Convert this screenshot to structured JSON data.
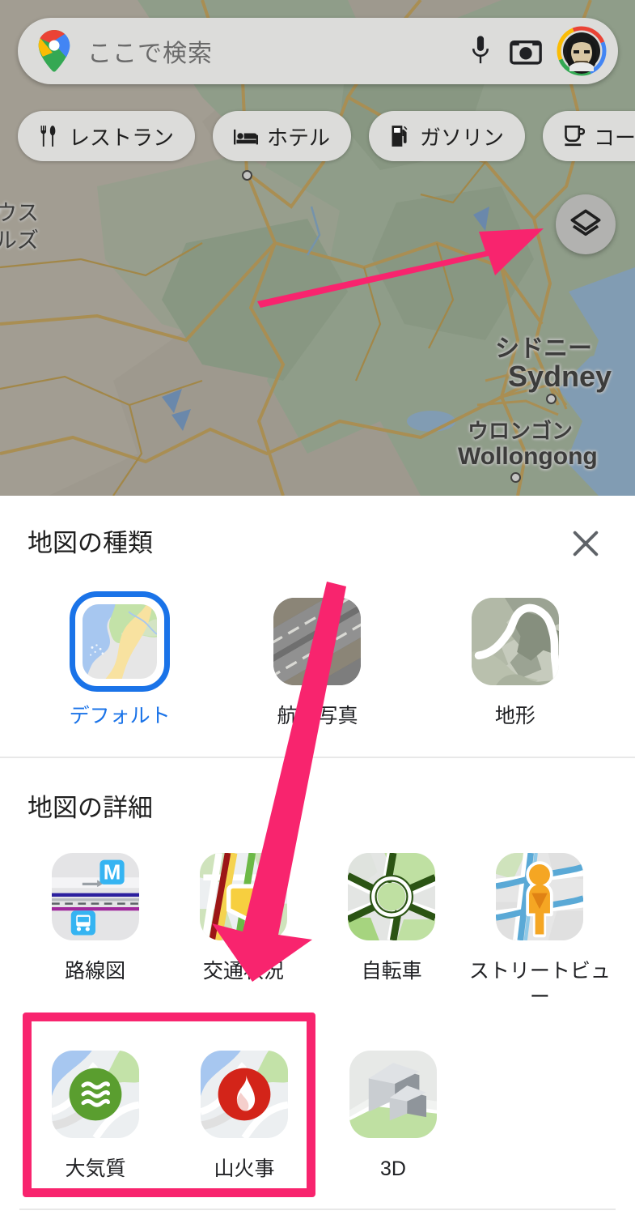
{
  "app": {
    "name": "Google Maps",
    "accent_blue": "#1a73e8",
    "annotation_pink": "#f8246e"
  },
  "search": {
    "placeholder": "ここで検索",
    "value": "",
    "logo_icon": "google-maps-pin-icon",
    "voice_icon": "microphone-icon",
    "camera_icon": "camera-icon",
    "avatar_icon": "account-avatar"
  },
  "chips": [
    {
      "label": "レストラン",
      "icon": "restaurant-icon"
    },
    {
      "label": "ホテル",
      "icon": "hotel-icon"
    },
    {
      "label": "ガソリン",
      "icon": "gas-station-icon"
    },
    {
      "label": "コーヒー",
      "icon": "coffee-icon"
    }
  ],
  "map": {
    "layers_button_icon": "layers-icon",
    "labels": [
      {
        "name": "region-label",
        "text": "ウス"
      },
      {
        "name": "region-label-2",
        "text": "ルズ"
      },
      {
        "name": "city-label-sydney-ja",
        "text": "シドニー"
      },
      {
        "name": "city-label-sydney-en",
        "text": "Sydney"
      },
      {
        "name": "city-label-wollongong-ja",
        "text": "ウロンゴン"
      },
      {
        "name": "city-label-wollongong-en",
        "text": "Wollongong"
      }
    ]
  },
  "sheet": {
    "title": "地図の種類",
    "close_icon": "close-icon",
    "map_types": [
      {
        "label": "デフォルト",
        "icon": "map-default-icon",
        "selected": true
      },
      {
        "label": "航空写真",
        "icon": "map-satellite-icon",
        "selected": false
      },
      {
        "label": "地形",
        "icon": "map-terrain-icon",
        "selected": false
      }
    ],
    "details_title": "地図の詳細",
    "details": [
      {
        "label": "路線図",
        "icon": "transit-icon",
        "highlighted": false
      },
      {
        "label": "交通状況",
        "icon": "traffic-icon",
        "highlighted": false
      },
      {
        "label": "自転車",
        "icon": "bicycling-icon",
        "highlighted": false
      },
      {
        "label": "ストリートビュー",
        "icon": "street-view-icon",
        "highlighted": false
      },
      {
        "label": "大気質",
        "icon": "air-quality-icon",
        "highlighted": true
      },
      {
        "label": "山火事",
        "icon": "wildfire-icon",
        "highlighted": true
      },
      {
        "label": "3D",
        "icon": "three-d-icon",
        "highlighted": false
      }
    ]
  },
  "annotations": {
    "arrow_to_layers_button": "pink-arrow-right",
    "arrow_to_details": "pink-arrow-down",
    "highlight_box": "pink-highlight-box"
  }
}
